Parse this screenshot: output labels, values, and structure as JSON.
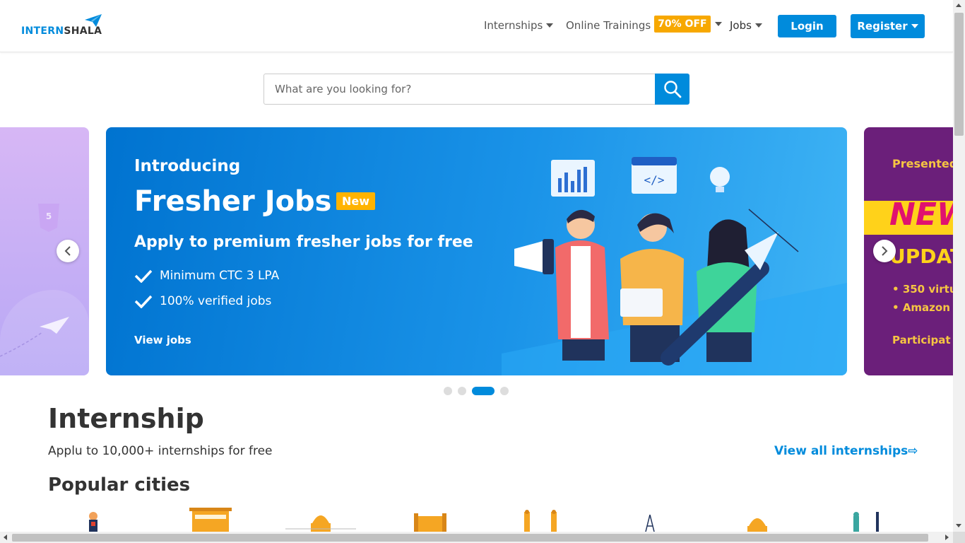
{
  "brand": {
    "logo_part1": "INTERN",
    "logo_part2": "SHALA"
  },
  "nav": {
    "internships": "Internships",
    "online_trainings": "Online Trainings",
    "trainings_badge": "70% OFF",
    "jobs": "Jobs",
    "login": "Login",
    "register": "Register"
  },
  "search": {
    "placeholder": "What are you looking for?"
  },
  "carousel": {
    "main": {
      "intro": "Introducing",
      "title": "Fresher Jobs",
      "badge": "New",
      "subtitle": "Apply to premium fresher jobs for free",
      "bullets": [
        "Minimum CTC 3 LPA",
        "100% verified jobs"
      ],
      "cta": "View jobs"
    },
    "right": {
      "presented": "Presented",
      "headline": "NEW",
      "subheadline": "UPDAT",
      "bullets": [
        "350 virtu",
        "Amazon"
      ],
      "cta": "Participat"
    },
    "active_index": 2,
    "slide_count": 4
  },
  "internship_section": {
    "title": "Internship",
    "subtitle": "Applu to 10,000+ internships for free",
    "view_all": "View all internships⇨",
    "cities_title": "Popular cities"
  },
  "colors": {
    "accent": "#008bdc",
    "badge": "#f7a800",
    "text": "#333333"
  }
}
